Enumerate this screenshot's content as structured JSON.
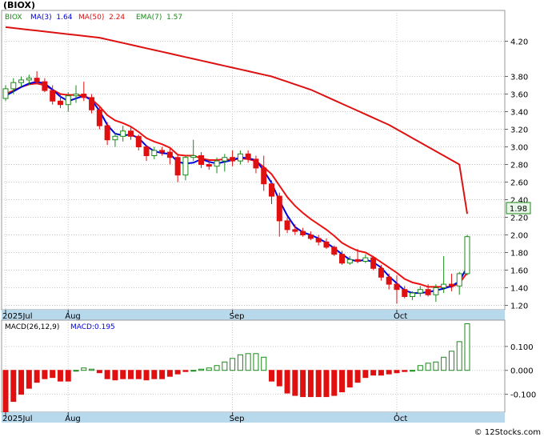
{
  "title": "(BIOX)",
  "legend": {
    "ticker": "BIOX",
    "ma3": "MA(3)  1.64",
    "ma50": "MA(50)  2.24",
    "ema7": "EMA(7)  1.57"
  },
  "last_price": "1.98",
  "footer": "© 12Stocks.com",
  "colors": {
    "up": "#1a8a1a",
    "down": "#e01010",
    "ma_fast": "#0000dd",
    "ma_slow": "#dd1111",
    "axis_band": "#b8d8ec",
    "grid": "#c8c8c8"
  },
  "chart_data": [
    {
      "type": "candlestick",
      "title": "(BIOX)",
      "ylim": [
        1.15,
        4.55
      ],
      "yticks": [
        "4.20",
        "3.80",
        "3.60",
        "3.40",
        "3.20",
        "3.00",
        "2.80",
        "2.60",
        "2.40",
        "2.20",
        "2.00",
        "1.80",
        "1.60",
        "1.40",
        "1.20"
      ],
      "x_labels": [
        {
          "i": 0,
          "text": "2025Jul"
        },
        {
          "i": 8,
          "text": "Aug"
        },
        {
          "i": 29,
          "text": "Sep"
        },
        {
          "i": 50,
          "text": "Oct"
        }
      ],
      "candles": [
        [
          3.55,
          3.7,
          3.52,
          3.66
        ],
        [
          3.66,
          3.78,
          3.6,
          3.73
        ],
        [
          3.73,
          3.8,
          3.68,
          3.76
        ],
        [
          3.76,
          3.82,
          3.7,
          3.78
        ],
        [
          3.78,
          3.86,
          3.72,
          3.74
        ],
        [
          3.74,
          3.78,
          3.62,
          3.64
        ],
        [
          3.64,
          3.7,
          3.48,
          3.52
        ],
        [
          3.52,
          3.6,
          3.44,
          3.48
        ],
        [
          3.48,
          3.62,
          3.4,
          3.58
        ],
        [
          3.58,
          3.7,
          3.5,
          3.6
        ],
        [
          3.6,
          3.74,
          3.52,
          3.56
        ],
        [
          3.56,
          3.6,
          3.38,
          3.42
        ],
        [
          3.42,
          3.46,
          3.2,
          3.24
        ],
        [
          3.24,
          3.28,
          3.02,
          3.08
        ],
        [
          3.08,
          3.16,
          3.0,
          3.12
        ],
        [
          3.12,
          3.24,
          3.06,
          3.18
        ],
        [
          3.18,
          3.22,
          3.08,
          3.12
        ],
        [
          3.12,
          3.14,
          2.96,
          3.0
        ],
        [
          3.0,
          3.02,
          2.84,
          2.9
        ],
        [
          2.9,
          3.0,
          2.86,
          2.96
        ],
        [
          2.96,
          3.0,
          2.9,
          2.94
        ],
        [
          2.94,
          2.98,
          2.8,
          2.88
        ],
        [
          2.88,
          2.92,
          2.6,
          2.68
        ],
        [
          2.68,
          2.9,
          2.62,
          2.88
        ],
        [
          2.88,
          3.08,
          2.84,
          2.9
        ],
        [
          2.9,
          2.94,
          2.76,
          2.8
        ],
        [
          2.8,
          2.86,
          2.74,
          2.78
        ],
        [
          2.78,
          2.88,
          2.7,
          2.84
        ],
        [
          2.84,
          2.92,
          2.72,
          2.88
        ],
        [
          2.88,
          2.96,
          2.78,
          2.84
        ],
        [
          2.84,
          2.96,
          2.8,
          2.92
        ],
        [
          2.92,
          2.96,
          2.82,
          2.86
        ],
        [
          2.86,
          2.9,
          2.7,
          2.76
        ],
        [
          2.76,
          2.9,
          2.5,
          2.58
        ],
        [
          2.58,
          2.62,
          2.35,
          2.44
        ],
        [
          2.44,
          2.48,
          1.98,
          2.16
        ],
        [
          2.16,
          2.2,
          2.02,
          2.06
        ],
        [
          2.06,
          2.12,
          2.0,
          2.04
        ],
        [
          2.04,
          2.08,
          1.98,
          2.0
        ],
        [
          2.0,
          2.04,
          1.94,
          1.96
        ],
        [
          1.96,
          2.0,
          1.88,
          1.92
        ],
        [
          1.92,
          1.96,
          1.84,
          1.86
        ],
        [
          1.86,
          1.88,
          1.76,
          1.78
        ],
        [
          1.78,
          1.82,
          1.66,
          1.68
        ],
        [
          1.68,
          1.76,
          1.66,
          1.72
        ],
        [
          1.72,
          1.84,
          1.68,
          1.7
        ],
        [
          1.7,
          1.78,
          1.68,
          1.74
        ],
        [
          1.74,
          1.76,
          1.6,
          1.62
        ],
        [
          1.62,
          1.66,
          1.48,
          1.52
        ],
        [
          1.52,
          1.56,
          1.38,
          1.44
        ],
        [
          1.44,
          1.54,
          1.22,
          1.38
        ],
        [
          1.38,
          1.42,
          1.28,
          1.3
        ],
        [
          1.3,
          1.36,
          1.26,
          1.34
        ],
        [
          1.34,
          1.42,
          1.3,
          1.38
        ],
        [
          1.38,
          1.44,
          1.3,
          1.32
        ],
        [
          1.32,
          1.44,
          1.24,
          1.4
        ],
        [
          1.4,
          1.76,
          1.34,
          1.44
        ],
        [
          1.44,
          1.56,
          1.36,
          1.42
        ],
        [
          1.42,
          1.58,
          1.32,
          1.56
        ],
        [
          1.56,
          2.0,
          1.54,
          1.98
        ]
      ],
      "ma_fast": [
        3.58,
        3.63,
        3.68,
        3.72,
        3.74,
        3.72,
        3.65,
        3.57,
        3.52,
        3.55,
        3.58,
        3.53,
        3.41,
        3.25,
        3.15,
        3.13,
        3.14,
        3.1,
        3.01,
        2.95,
        2.93,
        2.92,
        2.83,
        2.81,
        2.82,
        2.86,
        2.83,
        2.81,
        2.83,
        2.85,
        2.88,
        2.87,
        2.85,
        2.73,
        2.59,
        2.39,
        2.22,
        2.09,
        2.03,
        2.0,
        1.96,
        1.91,
        1.85,
        1.78,
        1.72,
        1.7,
        1.72,
        1.69,
        1.63,
        1.53,
        1.45,
        1.37,
        1.34,
        1.34,
        1.35,
        1.37,
        1.39,
        1.42,
        1.47,
        1.64
      ],
      "ma_slow": [
        4.36,
        4.35,
        4.34,
        4.33,
        4.32,
        4.31,
        4.3,
        4.29,
        4.28,
        4.27,
        4.26,
        4.25,
        4.24,
        4.22,
        4.2,
        4.18,
        4.16,
        4.14,
        4.12,
        4.1,
        4.08,
        4.06,
        4.04,
        4.02,
        4.0,
        3.98,
        3.96,
        3.94,
        3.92,
        3.9,
        3.88,
        3.86,
        3.84,
        3.82,
        3.8,
        3.77,
        3.74,
        3.71,
        3.68,
        3.65,
        3.61,
        3.57,
        3.53,
        3.49,
        3.45,
        3.41,
        3.37,
        3.33,
        3.29,
        3.25,
        3.2,
        3.15,
        3.1,
        3.05,
        3.0,
        2.95,
        2.9,
        2.85,
        2.8,
        2.24
      ],
      "ma_slow_x_start": 0,
      "ema_fast": [
        3.6,
        3.64,
        3.68,
        3.71,
        3.72,
        3.7,
        3.65,
        3.6,
        3.59,
        3.59,
        3.58,
        3.54,
        3.46,
        3.36,
        3.3,
        3.27,
        3.23,
        3.17,
        3.1,
        3.06,
        3.03,
        2.99,
        2.91,
        2.9,
        2.9,
        2.87,
        2.85,
        2.85,
        2.86,
        2.85,
        2.87,
        2.86,
        2.84,
        2.77,
        2.69,
        2.56,
        2.43,
        2.33,
        2.25,
        2.18,
        2.12,
        2.06,
        1.99,
        1.91,
        1.86,
        1.82,
        1.8,
        1.75,
        1.69,
        1.63,
        1.57,
        1.5,
        1.46,
        1.44,
        1.41,
        1.41,
        1.41,
        1.41,
        1.45,
        1.57
      ]
    },
    {
      "type": "macd",
      "title": "MACD(26,12,9)",
      "label": "MACD:0.195",
      "ylim": [
        -0.175,
        0.21
      ],
      "yticks": [
        "0.100",
        "0.000",
        "-0.100"
      ],
      "x_labels": [
        {
          "i": 0,
          "text": "2025Jul"
        },
        {
          "i": 8,
          "text": "Aug"
        },
        {
          "i": 29,
          "text": "Sep"
        },
        {
          "i": 50,
          "text": "Oct"
        }
      ],
      "histogram": [
        -0.175,
        -0.13,
        -0.1,
        -0.075,
        -0.05,
        -0.035,
        -0.03,
        -0.045,
        -0.045,
        0.0,
        0.01,
        0.005,
        -0.01,
        -0.035,
        -0.04,
        -0.035,
        -0.035,
        -0.035,
        -0.04,
        -0.035,
        -0.035,
        -0.025,
        -0.015,
        -0.005,
        0.0,
        0.005,
        0.01,
        0.02,
        0.035,
        0.05,
        0.065,
        0.07,
        0.07,
        0.055,
        -0.045,
        -0.065,
        -0.095,
        -0.105,
        -0.11,
        -0.11,
        -0.11,
        -0.11,
        -0.105,
        -0.09,
        -0.07,
        -0.05,
        -0.03,
        -0.02,
        -0.02,
        -0.015,
        -0.01,
        -0.005,
        0.0,
        0.02,
        0.03,
        0.035,
        0.055,
        0.08,
        0.12,
        0.195
      ]
    }
  ]
}
